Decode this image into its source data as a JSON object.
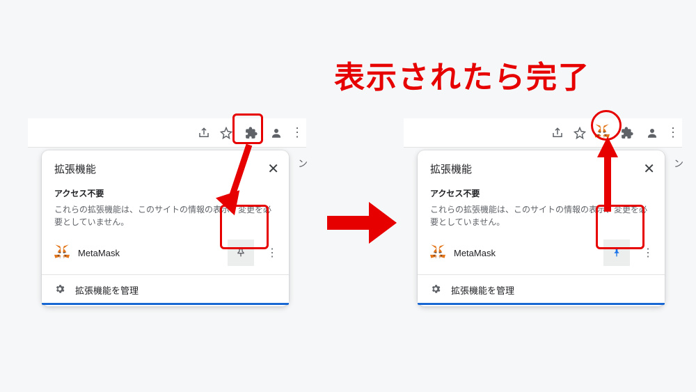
{
  "annotation": "表示されたら完了",
  "toolbar": {},
  "popup": {
    "title": "拡張機能",
    "close": "✕",
    "section_subtitle": "アクセス不要",
    "section_desc": "これらの拡張機能は、このサイトの情報の表示、変更を必要としていません。",
    "extension_name": "MetaMask",
    "manage_label": "拡張機能を管理"
  },
  "hidden_char": "ン"
}
